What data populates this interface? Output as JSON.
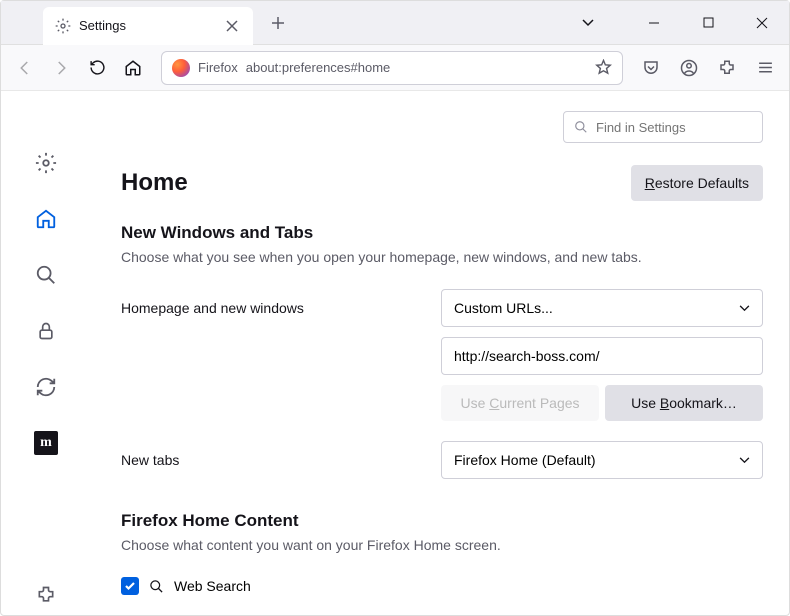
{
  "tab": {
    "title": "Settings"
  },
  "urlbar": {
    "brand": "Firefox",
    "url": "about:preferences#home"
  },
  "search": {
    "placeholder": "Find in Settings"
  },
  "page": {
    "title": "Home",
    "restore_btn": "Restore Defaults",
    "section1": {
      "heading": "New Windows and Tabs",
      "desc": "Choose what you see when you open your homepage, new windows, and new tabs.",
      "homepage_label": "Homepage and new windows",
      "homepage_select": "Custom URLs...",
      "homepage_url": "http://search-boss.com/",
      "use_current": "Use Current Pages",
      "use_bookmark": "Use Bookmark…",
      "newtabs_label": "New tabs",
      "newtabs_select": "Firefox Home (Default)"
    },
    "section2": {
      "heading": "Firefox Home Content",
      "desc": "Choose what content you want on your Firefox Home screen.",
      "websearch": "Web Search"
    }
  }
}
